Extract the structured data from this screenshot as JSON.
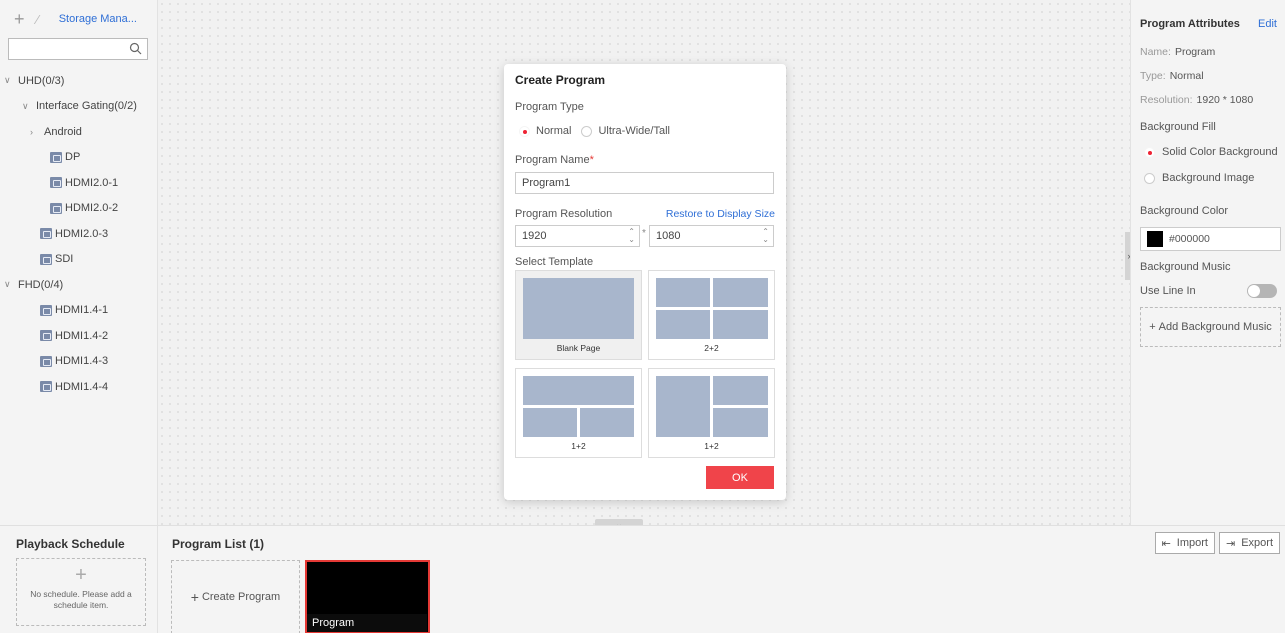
{
  "left_panel": {
    "storage_label": "Storage Mana...",
    "tree": [
      {
        "label": "UHD(0/3)",
        "type": "group-open",
        "indent": 0
      },
      {
        "label": "Interface Gating(0/2)",
        "type": "group-open",
        "indent": 1
      },
      {
        "label": "Android",
        "type": "group-closed",
        "indent": 2
      },
      {
        "label": "DP",
        "type": "source",
        "indent": 3
      },
      {
        "label": "HDMI2.0-1",
        "type": "source",
        "indent": 3
      },
      {
        "label": "HDMI2.0-2",
        "type": "source",
        "indent": 3
      },
      {
        "label": "HDMI2.0-3",
        "type": "source",
        "indent": 2
      },
      {
        "label": "SDI",
        "type": "source",
        "indent": 2
      },
      {
        "label": "FHD(0/4)",
        "type": "group-open",
        "indent": 0
      },
      {
        "label": "HDMI1.4-1",
        "type": "source",
        "indent": 2
      },
      {
        "label": "HDMI1.4-2",
        "type": "source",
        "indent": 2
      },
      {
        "label": "HDMI1.4-3",
        "type": "source",
        "indent": 2
      },
      {
        "label": "HDMI1.4-4",
        "type": "source",
        "indent": 2
      }
    ]
  },
  "right_panel": {
    "title": "Program Attributes",
    "edit": "Edit",
    "name_key": "Name:",
    "name_val": "Program",
    "type_key": "Type:",
    "type_val": "Normal",
    "res_key": "Resolution:",
    "res_val": "1920 * 1080",
    "bg_fill_label": "Background Fill",
    "bg_fill_options": [
      "Solid Color Background",
      "Background Image"
    ],
    "bg_color_label": "Background Color",
    "bg_color_value": "#000000",
    "bg_music_label": "Background Music",
    "use_line_in": "Use Line In",
    "add_music": "Add Background Music"
  },
  "bottom": {
    "schedule_title": "Playback Schedule",
    "schedule_empty": "No schedule. Please add a schedule item.",
    "program_list_title": "Program List (1)",
    "create_program": "Create Program",
    "program_card_label": "Program",
    "import_label": "Import",
    "export_label": "Export"
  },
  "modal": {
    "title": "Create Program",
    "program_type_label": "Program Type",
    "type_options": [
      "Normal",
      "Ultra-Wide/Tall"
    ],
    "program_name_label": "Program Name",
    "required_mark": "*",
    "program_name_value": "Program1",
    "resolution_label": "Program Resolution",
    "restore_label": "Restore to Display Size",
    "width_value": "1920",
    "height_value": "1080",
    "times": "*",
    "select_template_label": "Select Template",
    "templates": [
      "Blank Page",
      "2+2",
      "1+2",
      "1+2"
    ],
    "ok_label": "OK"
  },
  "colors": {
    "accent_red": "#f0444a",
    "link_blue": "#2f6fd6",
    "template_cell": "#a8b6cc"
  }
}
